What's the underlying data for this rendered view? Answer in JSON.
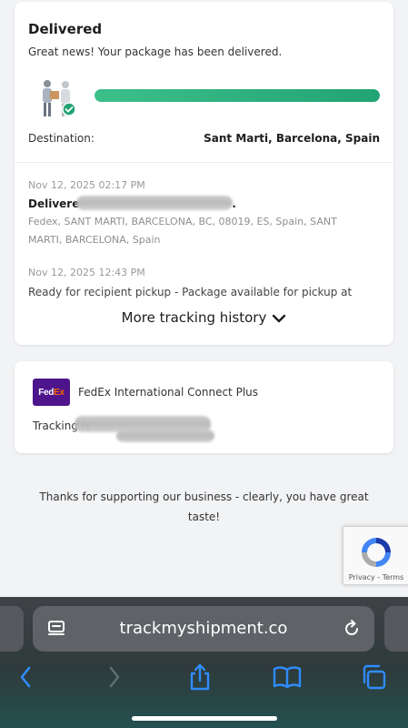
{
  "status_card": {
    "title": "Delivered",
    "subtitle": "Great news! Your package has been delivered.",
    "progress": 1.0,
    "destination_label": "Destination:",
    "destination_value": "Sant Marti, Barcelona, Spain",
    "events": [
      {
        "time": "Nov 12, 2025 02:17 PM",
        "title": "Delivere",
        "title_tail": ".",
        "detail": "Fedex, SANT MARTI, BARCELONA, BC, 08019, ES, Spain, SANT MARTI, BARCELONA, Spain"
      },
      {
        "time": "Nov 12, 2025 12:43 PM",
        "description": "Ready for recipient pickup - Package available for pickup at"
      }
    ],
    "more_label": "More tracking history"
  },
  "carrier_card": {
    "logo_fed": "Fed",
    "logo_ex": "Ex",
    "service": "FedEx International Connect Plus",
    "tracking_label": "Tracking N"
  },
  "footer": {
    "thanks": "Thanks for supporting our business - clearly, you have great taste!"
  },
  "recaptcha": {
    "links": "Privacy - Terms"
  },
  "browser": {
    "url": "trackmyshipment.co"
  },
  "colors": {
    "progress": "#22a374",
    "fedex_purple": "#4d148c",
    "fedex_orange": "#ff6200",
    "ios_blue": "#2f8cff"
  }
}
